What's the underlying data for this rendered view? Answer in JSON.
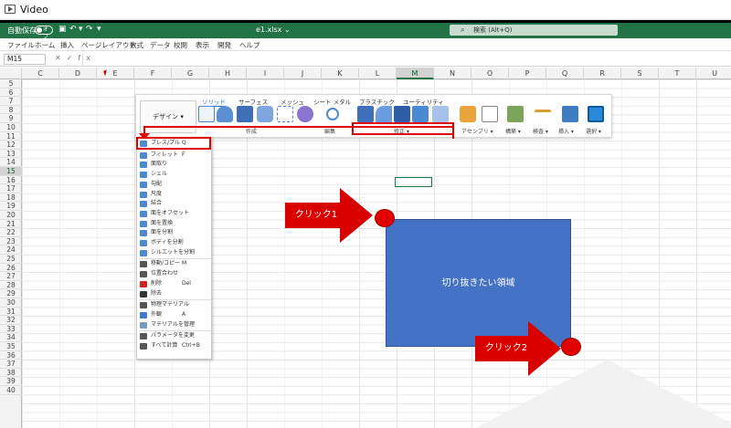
{
  "window": {
    "title": "Video"
  },
  "excel": {
    "autosave_label": "自動保存",
    "autosave_state": "オフ",
    "filename": "e1.xlsx",
    "search_placeholder": "検索 (Alt+Q)",
    "menu": [
      "ファイル",
      "ホーム",
      "挿入",
      "ページレイアウト",
      "数式",
      "データ",
      "校閲",
      "表示",
      "開発",
      "ヘルプ"
    ],
    "name_box": "M15",
    "fx": "fx",
    "columns": [
      "C",
      "D",
      "E",
      "F",
      "G",
      "H",
      "I",
      "J",
      "K",
      "L",
      "M",
      "N",
      "O",
      "P",
      "Q",
      "R",
      "S",
      "T",
      "U"
    ],
    "selected_column": "M",
    "rows": [
      "5",
      "6",
      "7",
      "8",
      "9",
      "10",
      "11",
      "12",
      "13",
      "14",
      "15",
      "16",
      "17",
      "18",
      "19",
      "20",
      "21",
      "22",
      "23",
      "24",
      "25",
      "26",
      "27",
      "28",
      "29",
      "30",
      "31",
      "32",
      "33",
      "34",
      "35",
      "36",
      "37",
      "38",
      "39",
      "40"
    ],
    "selected_row": "15"
  },
  "ribbon": {
    "design_button": "デザイン ▾",
    "tabs": [
      {
        "label": "ソリッド",
        "active": true
      },
      {
        "label": "サーフェス",
        "active": false
      },
      {
        "label": "メッシュ",
        "active": false
      },
      {
        "label": "シート メタル",
        "active": false
      },
      {
        "label": "プラスチック",
        "active": false
      },
      {
        "label": "ユーティリティ",
        "active": false
      }
    ],
    "groups": [
      "作成",
      "編集",
      "修正 ▾",
      "アセンブリ ▾",
      "構築 ▾",
      "検査 ▾",
      "挿入 ▾",
      "選択 ▾"
    ]
  },
  "modify_menu": {
    "items": [
      {
        "label": "プレス/プル",
        "shortcut": "Q",
        "color": "#4a8ad4"
      },
      {
        "label": "フィレット",
        "shortcut": "F",
        "color": "#4a8ad4"
      },
      {
        "label": "面取り",
        "shortcut": "",
        "color": "#4a8ad4"
      },
      {
        "label": "シェル",
        "shortcut": "",
        "color": "#4a8ad4"
      },
      {
        "label": "勾配",
        "shortcut": "",
        "color": "#4a8ad4"
      },
      {
        "label": "尺度",
        "shortcut": "",
        "color": "#4a8ad4"
      },
      {
        "label": "結合",
        "shortcut": "",
        "color": "#4a8ad4"
      },
      {
        "label": "面をオフセット",
        "shortcut": "",
        "color": "#4a8ad4"
      },
      {
        "label": "面を置換",
        "shortcut": "",
        "color": "#4a8ad4"
      },
      {
        "label": "面を分割",
        "shortcut": "",
        "color": "#4a8ad4"
      },
      {
        "label": "ボディを分割",
        "shortcut": "",
        "color": "#4a8ad4"
      },
      {
        "label": "シルエットを分割",
        "shortcut": "",
        "color": "#4a8ad4"
      },
      {
        "label": "移動/コピー",
        "shortcut": "M",
        "color": "#555555"
      },
      {
        "label": "位置合わせ",
        "shortcut": "",
        "color": "#555555"
      },
      {
        "label": "削除",
        "shortcut": "Del",
        "color": "#d42020"
      },
      {
        "label": "除去",
        "shortcut": "",
        "color": "#333333"
      },
      {
        "label": "物理マテリアル",
        "shortcut": "",
        "color": "#555555"
      },
      {
        "label": "外観",
        "shortcut": "A",
        "color": "#3a7ad0"
      },
      {
        "label": "マテリアルを管理",
        "shortcut": "",
        "color": "#7a9ac0"
      },
      {
        "label": "パラメータを変更",
        "shortcut": "",
        "color": "#555555"
      },
      {
        "label": "すべて計算",
        "shortcut": "Ctrl+B",
        "color": "#555555"
      }
    ]
  },
  "annotations": {
    "rect_label": "切り抜きたい領域",
    "click1": "クリック1",
    "click2": "クリック2",
    "accent_red": "#e00000",
    "rect_color": "#4472c4"
  }
}
